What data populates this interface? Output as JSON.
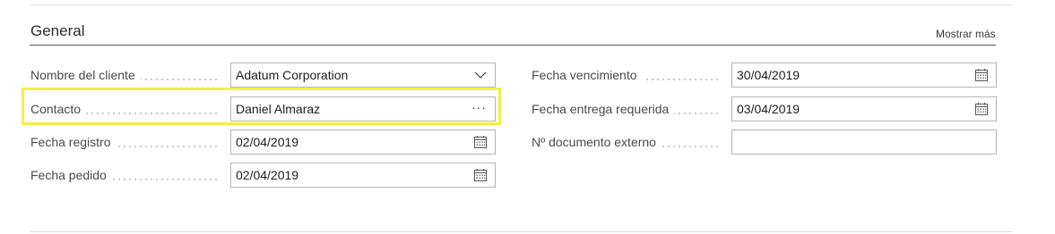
{
  "section": {
    "title": "General",
    "show_more_label": "Mostrar más"
  },
  "left_fields": [
    {
      "label": "Nombre del cliente",
      "value": "Adatum Corporation",
      "icon": "chevron-down-icon"
    },
    {
      "label": "Contacto",
      "value": "Daniel Almaraz",
      "icon": "ellipsis-icon",
      "ellipsis": "···"
    },
    {
      "label": "Fecha registro",
      "value": "02/04/2019",
      "icon": "calendar-icon"
    },
    {
      "label": "Fecha pedido",
      "value": "02/04/2019",
      "icon": "calendar-icon"
    }
  ],
  "right_fields": [
    {
      "label": "Fecha vencimiento",
      "value": "30/04/2019",
      "icon": "calendar-icon"
    },
    {
      "label": "Fecha entrega requerida",
      "value": "03/04/2019",
      "icon": "calendar-icon"
    },
    {
      "label": "Nº documento externo",
      "value": ""
    }
  ],
  "colors": {
    "highlight": "#f5ee46",
    "header_rule": "#4a5a66",
    "field_border": "#b5b5b5"
  }
}
